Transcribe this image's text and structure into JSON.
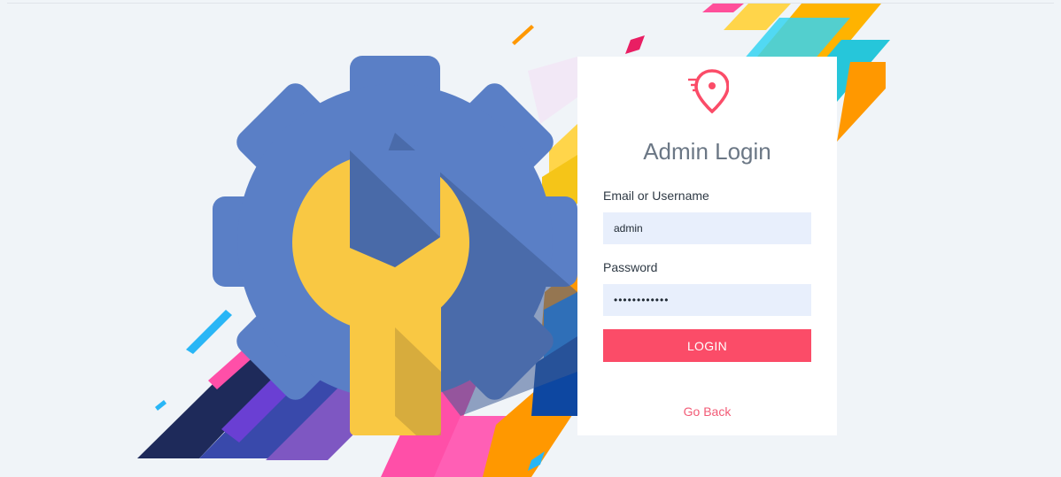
{
  "page": {
    "background_color": "#f0f4f8"
  },
  "illustration": {
    "icon": "gear-wrench-illustration",
    "gear_color": "#5a7fc6",
    "wrench_color": "#f9c843"
  },
  "login_card": {
    "logo_icon": "location-pin-icon",
    "accent_color": "#fb4c68",
    "title": "Admin Login",
    "username_label": "Email or Username",
    "username_value": "admin",
    "password_label": "Password",
    "password_value": "••••••••••••",
    "login_button_label": "LOGIN",
    "go_back_label": "Go Back"
  }
}
